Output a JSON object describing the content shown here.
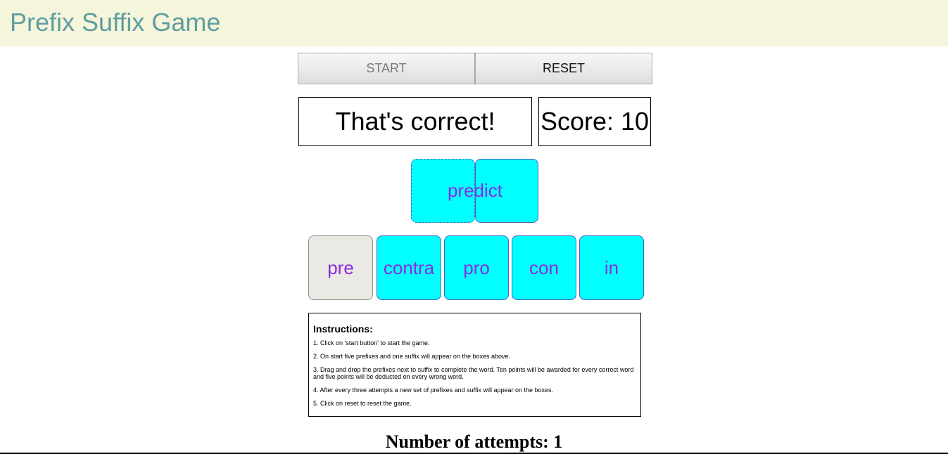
{
  "header": {
    "title": "Prefix Suffix Game"
  },
  "controls": {
    "start_label": "START",
    "reset_label": "RESET"
  },
  "status": {
    "message": "That's correct!",
    "score_text": "Score: 10"
  },
  "word": {
    "text": "predict"
  },
  "prefixes": [
    {
      "label": "pre",
      "used": true
    },
    {
      "label": "contra",
      "used": false
    },
    {
      "label": "pro",
      "used": false
    },
    {
      "label": "con",
      "used": false
    },
    {
      "label": "in",
      "used": false
    }
  ],
  "instructions": {
    "title": "Instructions:",
    "items": [
      "1. Click on 'start button' to start the game.",
      "2. On start five prefixes and one suffix will appear on the boxes above.",
      "3. Drag and drop the prefixes next to suffix to complete the word. Ten points will be awarded for every correct word and five points will be deducted on every wrong word.",
      "4. After every three attempts a new set of prefixes and suffix will appear on the boxes.",
      "5. Click on reset to reset the game."
    ]
  },
  "attempts": {
    "text": "Number of attempts: 1"
  },
  "colors": {
    "header_bg": "#f5f5dc",
    "header_text": "#5f9ea0",
    "tile_bg": "#00ffff",
    "tile_text": "#8a2be2",
    "used_tile_bg": "#ebe9e4"
  }
}
